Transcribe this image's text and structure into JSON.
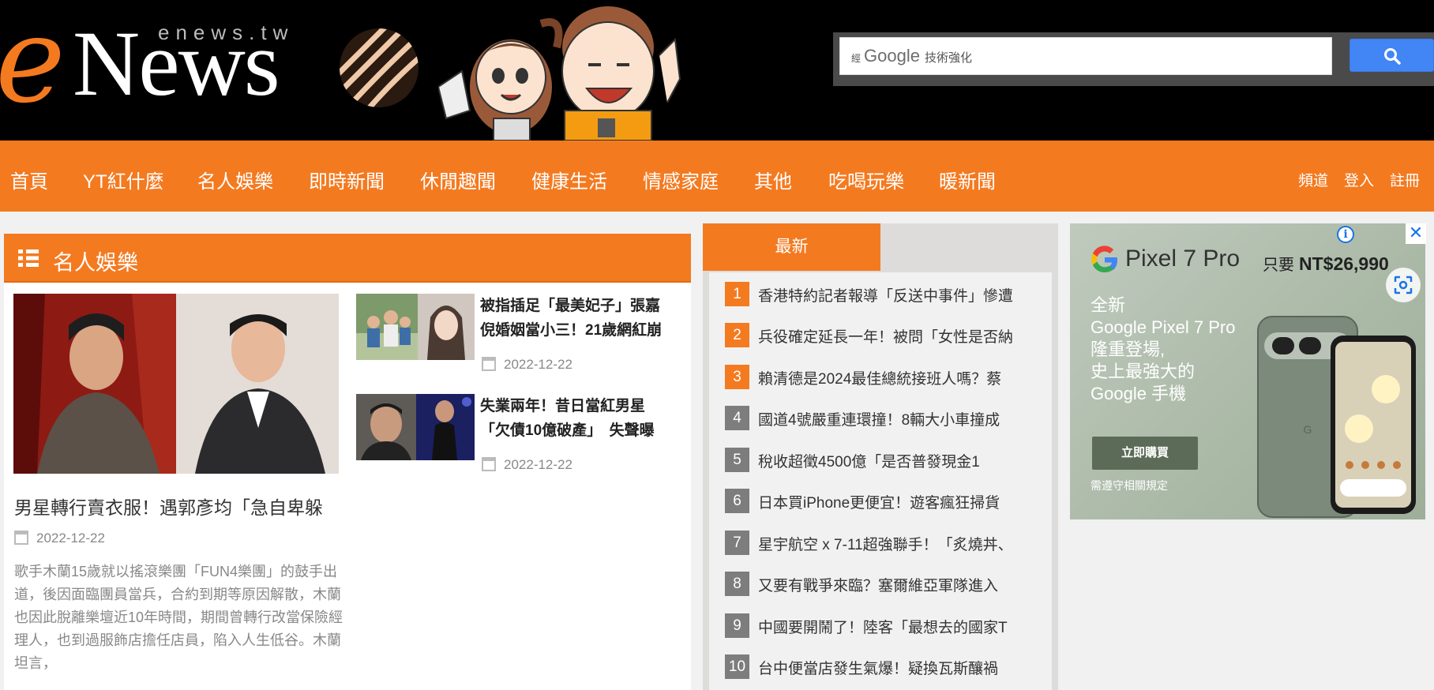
{
  "header": {
    "logo_e": "e",
    "logo_news": "News",
    "logo_sub": "enews.tw",
    "search": {
      "brand_prefix": "經",
      "brand_google": "Google",
      "brand_suffix": "技術強化",
      "button_icon": "search-icon"
    }
  },
  "nav": {
    "items": [
      "首頁",
      "YT紅什麼",
      "名人娛樂",
      "即時新聞",
      "休閒趣聞",
      "健康生活",
      "情感家庭",
      "其他",
      "吃喝玩樂",
      "暖新聞"
    ],
    "right": [
      "頻道",
      "登入",
      "註冊"
    ]
  },
  "section": {
    "icon": "list-icon",
    "title": "名人娛樂",
    "featured": {
      "title": "男星轉行賣衣服！遇郭彥均「急自卑躲",
      "date": "2022-12-22",
      "excerpt": "歌手木蘭15歲就以搖滾樂團「FUN4樂團」的鼓手出道，後因面臨團員當兵，合約到期等原因解散，木蘭也因此脫離樂壇近10年時間，期間曾轉行改當保險經理人，也到過服飾店擔任店員，陷入人生低谷。木蘭坦言，"
    },
    "side_items": [
      {
        "title_line1": "被指插足「最美妃子」張嘉",
        "title_line2": "倪婚姻當小三！21歲網紅崩",
        "date": "2022-12-22"
      },
      {
        "title_line1": "失業兩年！昔日當紅男星",
        "title_line2": "「欠債10億破產」　失聲曝",
        "date": "2022-12-22"
      }
    ]
  },
  "latest": {
    "tab_label": "最新",
    "highlight_color": "#f47a20",
    "default_color": "#7d7d7d",
    "items": [
      {
        "num": "1",
        "text": "香港特約記者報導「反送中事件」慘遭"
      },
      {
        "num": "2",
        "text": "兵役確定延長一年！被問「女性是否納"
      },
      {
        "num": "3",
        "text": "賴清德是2024最佳總統接班人嗎？蔡"
      },
      {
        "num": "4",
        "text": "國道4號嚴重連環撞！8輛大小車撞成"
      },
      {
        "num": "5",
        "text": "稅收超徵4500億「是否普發現金1"
      },
      {
        "num": "6",
        "text": "日本買iPhone更便宜！遊客瘋狂掃貨"
      },
      {
        "num": "7",
        "text": "星宇航空 x 7-11超強聯手！「炙燒丼、"
      },
      {
        "num": "8",
        "text": "又要有戰爭來臨？塞爾維亞軍隊進入"
      },
      {
        "num": "9",
        "text": "中國要開鬧了！陸客「最想去的國家T"
      },
      {
        "num": "10",
        "text": "台中便當店發生氣爆！疑換瓦斯釀禍"
      }
    ]
  },
  "ad": {
    "brand": "Pixel 7 Pro",
    "price_prefix": "只要",
    "price": "NT$26,990",
    "copy": [
      "全新",
      "Google Pixel 7 Pro",
      "隆重登場,",
      "史上最強大的",
      "Google 手機"
    ],
    "cta": "立即購買",
    "note": "需遵守相關規定",
    "info_icon": "info-icon",
    "close_icon": "close-icon",
    "lens_icon": "lens-icon"
  }
}
